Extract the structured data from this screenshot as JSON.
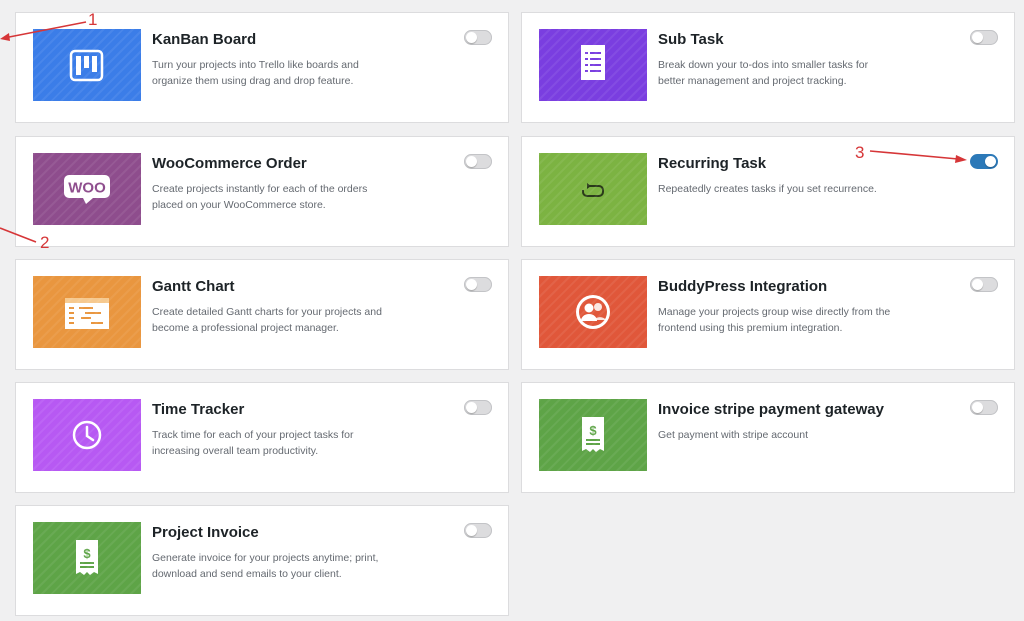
{
  "modules": [
    {
      "title": "KanBan Board",
      "desc": "Turn your projects into Trello like boards and organize them using drag and drop feature.",
      "enabled": false,
      "color": "#3b7de8",
      "icon": "kanban-board-icon"
    },
    {
      "title": "Sub Task",
      "desc": "Break down your to-dos into smaller tasks for better management and project tracking.",
      "enabled": false,
      "color": "#7a3ee0",
      "icon": "subtask-document-icon"
    },
    {
      "title": "WooCommerce Order",
      "desc": "Create projects instantly for each of the orders placed on your WooCommerce store.",
      "enabled": false,
      "color": "#8e4d8d",
      "icon": "woocommerce-logo-icon"
    },
    {
      "title": "Recurring Task",
      "desc": "Repeatedly creates tasks if you set recurrence.",
      "enabled": true,
      "color": "#7cb342",
      "icon": "recurring-arrow-icon"
    },
    {
      "title": "Gantt Chart",
      "desc": "Create detailed Gantt charts for your projects and become a professional project manager.",
      "enabled": false,
      "color": "#e9963f",
      "icon": "gantt-chart-icon"
    },
    {
      "title": "BuddyPress Integration",
      "desc": "Manage your projects group wise directly from the frontend using this premium integration.",
      "enabled": false,
      "color": "#e0573a",
      "icon": "buddypress-users-icon"
    },
    {
      "title": "Time Tracker",
      "desc": "Track time for each of your project tasks for increasing overall team productivity.",
      "enabled": false,
      "color": "#b759f3",
      "icon": "clock-icon"
    },
    {
      "title": "Invoice stripe payment gateway",
      "desc": "Get payment with stripe account",
      "enabled": false,
      "color": "#5ea447",
      "icon": "invoice-dollar-icon"
    },
    {
      "title": "Project Invoice",
      "desc": "Generate invoice for your projects anytime; print, download and send emails to your client.",
      "enabled": false,
      "color": "#5ea447",
      "icon": "invoice-dollar-icon"
    }
  ],
  "annotations": [
    "1",
    "2",
    "3"
  ],
  "annotation_color": "#d63638",
  "toggle_on_color": "#2c79b8"
}
